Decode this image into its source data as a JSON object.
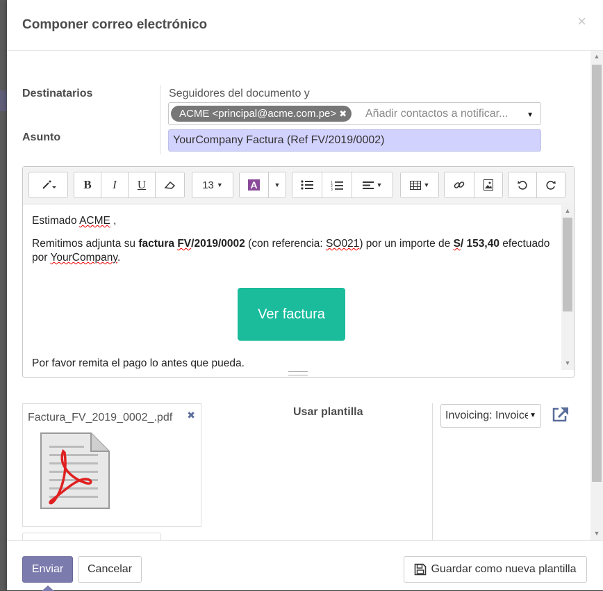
{
  "dialog": {
    "title": "Componer correo electrónico",
    "close_label": "×"
  },
  "form": {
    "recipients_label": "Destinatarios",
    "followers_text": "Seguidores del documento y",
    "recipient_tag": "ACME <principal@acme.com.pe>",
    "recipient_tag_remove": "✖",
    "recipients_placeholder": "Añadir contactos a notificar...",
    "subject_label": "Asunto",
    "subject_value": "YourCompany Factura (Ref FV/2019/0002)"
  },
  "toolbar": {
    "font_size": "13",
    "bold": "B",
    "italic": "I",
    "underline": "U",
    "color": "A"
  },
  "body": {
    "greeting_prefix": "Estimado ",
    "greeting_name": "ACME",
    "greeting_suffix": " ,",
    "p1_a": "Remitimos adjunta su ",
    "p1_b": "factura ",
    "p1_c": "FV",
    "p1_d": "/2019/0002",
    "p1_e": " (con referencia: ",
    "p1_f": "SO021",
    "p1_g": ") por un importe de ",
    "p1_h": "S",
    "p1_i": "/ 153,40",
    "p1_j": " efectuado por ",
    "p1_k": "YourCompany",
    "p1_l": ".",
    "cta_button": "Ver factura",
    "p3": "Por favor remita el pago lo antes que pueda."
  },
  "attachment": {
    "filename": "Factura_FV_2019_0002_.pdf",
    "remove": "✖"
  },
  "template": {
    "label": "Usar plantilla",
    "selected": "Invoicing: Invoice"
  },
  "footer": {
    "send": "Enviar",
    "cancel": "Cancelar",
    "save_template": "Guardar como nueva plantilla"
  },
  "colors": {
    "primary": "#7c7bad",
    "cta": "#1abc9c",
    "subject_bg": "#d2d2ff"
  }
}
